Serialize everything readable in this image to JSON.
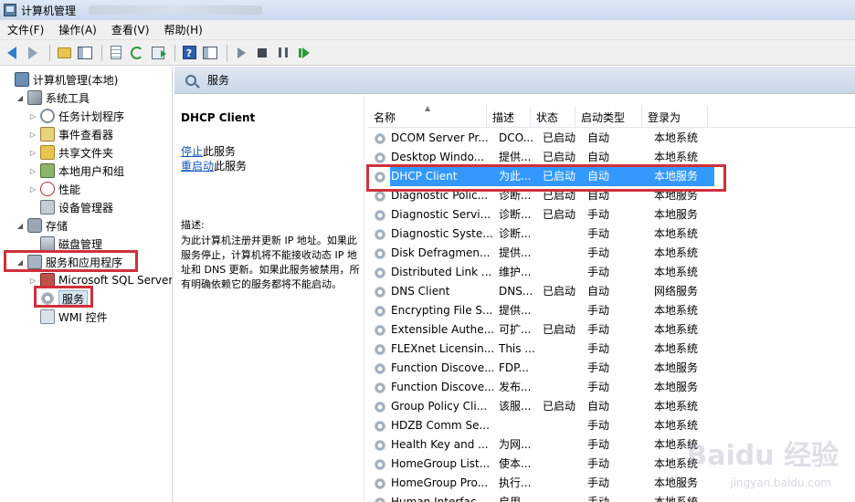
{
  "window": {
    "title": "计算机管理"
  },
  "menu": [
    "文件(F)",
    "操作(A)",
    "查看(V)",
    "帮助(H)"
  ],
  "tree": [
    {
      "label": "计算机管理(本地)",
      "icon": "computer-icon",
      "twisty": "",
      "indent": 0
    },
    {
      "label": "系统工具",
      "icon": "tools-icon",
      "twisty": "◢",
      "indent": 1
    },
    {
      "label": "任务计划程序",
      "icon": "clock-icon",
      "twisty": "▷",
      "indent": 2
    },
    {
      "label": "事件查看器",
      "icon": "event-viewer-icon",
      "twisty": "▷",
      "indent": 2
    },
    {
      "label": "共享文件夹",
      "icon": "shared-folder-icon",
      "twisty": "▷",
      "indent": 2
    },
    {
      "label": "本地用户和组",
      "icon": "users-icon",
      "twisty": "▷",
      "indent": 2
    },
    {
      "label": "性能",
      "icon": "performance-icon",
      "twisty": "▷",
      "indent": 2
    },
    {
      "label": "设备管理器",
      "icon": "device-manager-icon",
      "twisty": "",
      "indent": 2
    },
    {
      "label": "存储",
      "icon": "storage-icon",
      "twisty": "◢",
      "indent": 1
    },
    {
      "label": "磁盘管理",
      "icon": "disk-icon",
      "twisty": "",
      "indent": 2
    },
    {
      "label": "服务和应用程序",
      "icon": "services-apps-icon",
      "twisty": "◢",
      "indent": 1
    },
    {
      "label": "Microsoft SQL Server",
      "icon": "sql-server-icon",
      "twisty": "▷",
      "indent": 2
    },
    {
      "label": "服务",
      "icon": "gear-icon",
      "twisty": "",
      "indent": 2
    },
    {
      "label": "WMI 控件",
      "icon": "wmi-icon",
      "twisty": "",
      "indent": 2
    }
  ],
  "pane": {
    "title": "服务"
  },
  "detail": {
    "service_name": "DHCP Client",
    "stop_link": "停止",
    "stop_suffix": "此服务",
    "restart_link": "重启动",
    "restart_suffix": "此服务",
    "description_label": "描述:",
    "description": "为此计算机注册并更新 IP 地址。如果此服务停止，计算机将不能接收动态 IP 地址和 DNS 更新。如果此服务被禁用，所有明确依赖它的服务都将不能启动。"
  },
  "columns": [
    "名称",
    "描述",
    "状态",
    "启动类型",
    "登录为"
  ],
  "services": [
    {
      "name": "DCOM Server Pr...",
      "desc": "DCO...",
      "status": "已启动",
      "startup": "自动",
      "logon": "本地系统"
    },
    {
      "name": "Desktop Windo...",
      "desc": "提供...",
      "status": "已启动",
      "startup": "自动",
      "logon": "本地系统"
    },
    {
      "name": "DHCP Client",
      "desc": "为此...",
      "status": "已启动",
      "startup": "自动",
      "logon": "本地服务",
      "selected": true
    },
    {
      "name": "Diagnostic Polic...",
      "desc": "诊断...",
      "status": "已启动",
      "startup": "自动",
      "logon": "本地服务"
    },
    {
      "name": "Diagnostic Servi...",
      "desc": "诊断...",
      "status": "已启动",
      "startup": "手动",
      "logon": "本地服务"
    },
    {
      "name": "Diagnostic Syste...",
      "desc": "诊断...",
      "status": "",
      "startup": "手动",
      "logon": "本地系统"
    },
    {
      "name": "Disk Defragmen...",
      "desc": "提供...",
      "status": "",
      "startup": "手动",
      "logon": "本地系统"
    },
    {
      "name": "Distributed Link ...",
      "desc": "维护...",
      "status": "",
      "startup": "手动",
      "logon": "本地系统"
    },
    {
      "name": "DNS Client",
      "desc": "DNS...",
      "status": "已启动",
      "startup": "自动",
      "logon": "网络服务"
    },
    {
      "name": "Encrypting File S...",
      "desc": "提供...",
      "status": "",
      "startup": "手动",
      "logon": "本地系统"
    },
    {
      "name": "Extensible Authe...",
      "desc": "可扩...",
      "status": "已启动",
      "startup": "手动",
      "logon": "本地系统"
    },
    {
      "name": "FLEXnet Licensin...",
      "desc": "This ...",
      "status": "",
      "startup": "手动",
      "logon": "本地系统"
    },
    {
      "name": "Function Discove...",
      "desc": "FDP...",
      "status": "",
      "startup": "手动",
      "logon": "本地服务"
    },
    {
      "name": "Function Discove...",
      "desc": "发布...",
      "status": "",
      "startup": "手动",
      "logon": "本地服务"
    },
    {
      "name": "Group Policy Cli...",
      "desc": "该服...",
      "status": "已启动",
      "startup": "自动",
      "logon": "本地系统"
    },
    {
      "name": "HDZB Comm Se...",
      "desc": "",
      "status": "",
      "startup": "手动",
      "logon": "本地系统"
    },
    {
      "name": "Health Key and ...",
      "desc": "为网...",
      "status": "",
      "startup": "手动",
      "logon": "本地系统"
    },
    {
      "name": "HomeGroup List...",
      "desc": "使本...",
      "status": "",
      "startup": "手动",
      "logon": "本地系统"
    },
    {
      "name": "HomeGroup Pro...",
      "desc": "执行...",
      "status": "",
      "startup": "手动",
      "logon": "本地服务"
    },
    {
      "name": "Human Interfac...",
      "desc": "启用...",
      "status": "",
      "startup": "手动",
      "logon": "本地系统"
    }
  ],
  "watermark": {
    "text": "Baidu 经验",
    "sub": "jingyan.baidu.com"
  },
  "colors": {
    "selection": "#3399ff",
    "highlight_box": "#d1303a",
    "link": "#1a56b0"
  }
}
